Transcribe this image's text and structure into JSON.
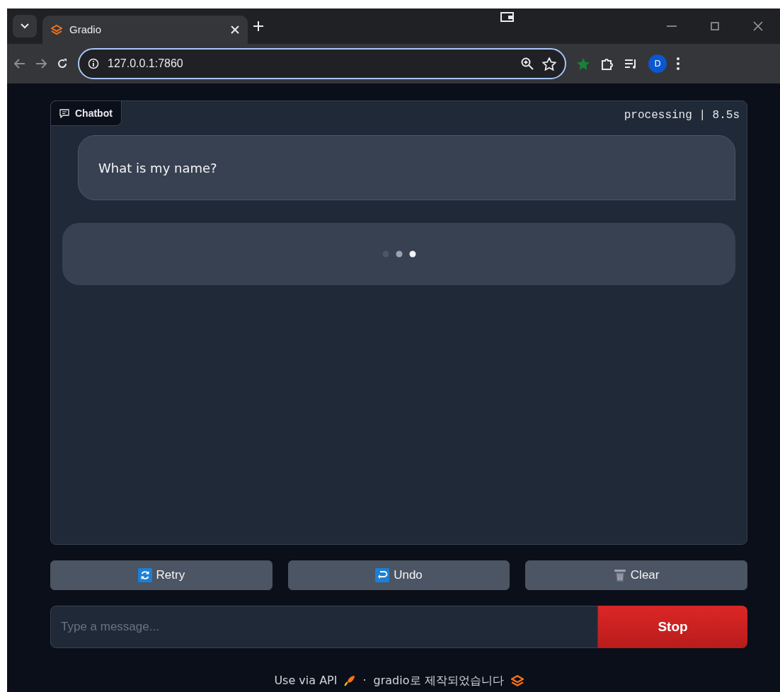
{
  "browser": {
    "tab": {
      "title": "Gradio"
    },
    "address": "127.0.0.1:7860",
    "profile_initial": "D"
  },
  "chatbot": {
    "label": "Chatbot",
    "status": "processing | 8.5s",
    "messages": [
      {
        "kind": "user",
        "text": "What is my name?"
      },
      {
        "kind": "typing"
      }
    ]
  },
  "buttons": [
    {
      "label": "Retry",
      "kind": "retry"
    },
    {
      "label": "Undo",
      "kind": "undo"
    },
    {
      "label": "Clear",
      "kind": "clear"
    }
  ],
  "input": {
    "placeholder": "Type a message..."
  },
  "submit": {
    "label": "Stop"
  },
  "footer": {
    "api_link": "Use via API",
    "separator": "·",
    "built_with": "gradio로 제작되었습니다"
  }
}
